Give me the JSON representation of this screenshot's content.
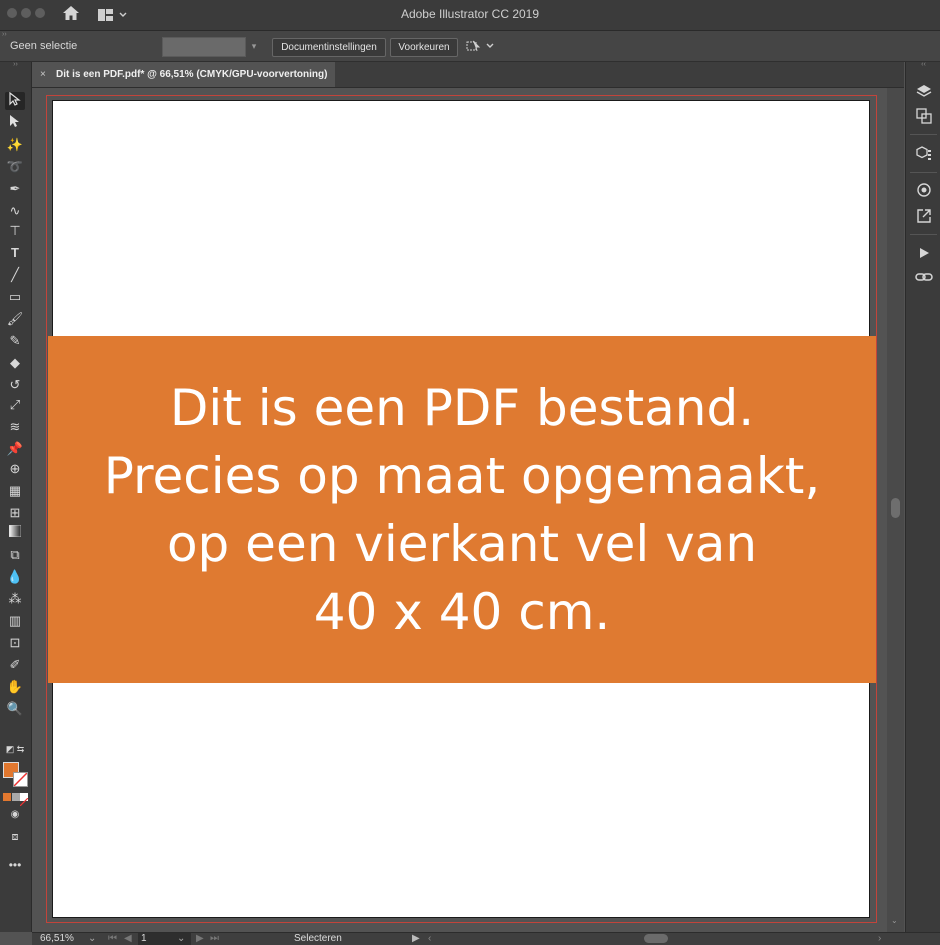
{
  "titlebar": {
    "app_title": "Adobe Illustrator CC 2019",
    "home_icon": "home-icon",
    "workspace_icon": "workspace-switcher-icon"
  },
  "controlbar": {
    "selection_label": "Geen selectie",
    "document_settings_label": "Documentinstellingen",
    "preferences_label": "Voorkeuren",
    "arrange_icon": "arrange-documents-icon"
  },
  "document_tab": {
    "close_glyph": "×",
    "title": "Dit is een PDF.pdf* @ 66,51% (CMYK/GPU-voorvertoning)"
  },
  "artboard": {
    "background": "#ffffff",
    "banner_color": "#df7a31",
    "banner_lines": [
      "Dit is een PDF bestand.",
      "Precies op maat opgemaakt,",
      "op een vierkant vel van",
      "40 x 40 cm."
    ]
  },
  "statusbar": {
    "zoom": "66,51%",
    "artboard_number": "1",
    "tool_status": "Selecteren"
  },
  "colors": {
    "fill": "#e2782f",
    "stroke": "none",
    "bleed_guide": "#c2443b"
  },
  "tools": [
    "selection-tool-icon",
    "direct-selection-tool-icon",
    "magic-wand-tool-icon",
    "lasso-tool-icon",
    "pen-tool-icon",
    "curvature-tool-icon",
    "type-tool-icon",
    "type-tool-icon",
    "line-tool-icon",
    "rectangle-tool-icon",
    "paintbrush-tool-icon",
    "shaper-tool-icon",
    "eraser-tool-icon",
    "rotate-tool-icon",
    "scale-tool-icon",
    "width-tool-icon",
    "puppet-warp-tool-icon",
    "shape-builder-tool-icon",
    "perspective-grid-tool-icon",
    "mesh-tool-icon",
    "gradient-tool-icon",
    "blend-tool-icon",
    "eyedropper-tool-icon",
    "symbol-sprayer-tool-icon",
    "column-graph-tool-icon",
    "artboard-tool-icon",
    "slice-tool-icon",
    "hand-tool-icon",
    "zoom-tool-icon"
  ],
  "right_panels": [
    "layers-panel-icon",
    "pathfinder-panel-icon",
    "libraries-panel-icon",
    "assets-export-icon",
    "export-icon",
    "actions-panel-icon",
    "links-panel-icon"
  ]
}
